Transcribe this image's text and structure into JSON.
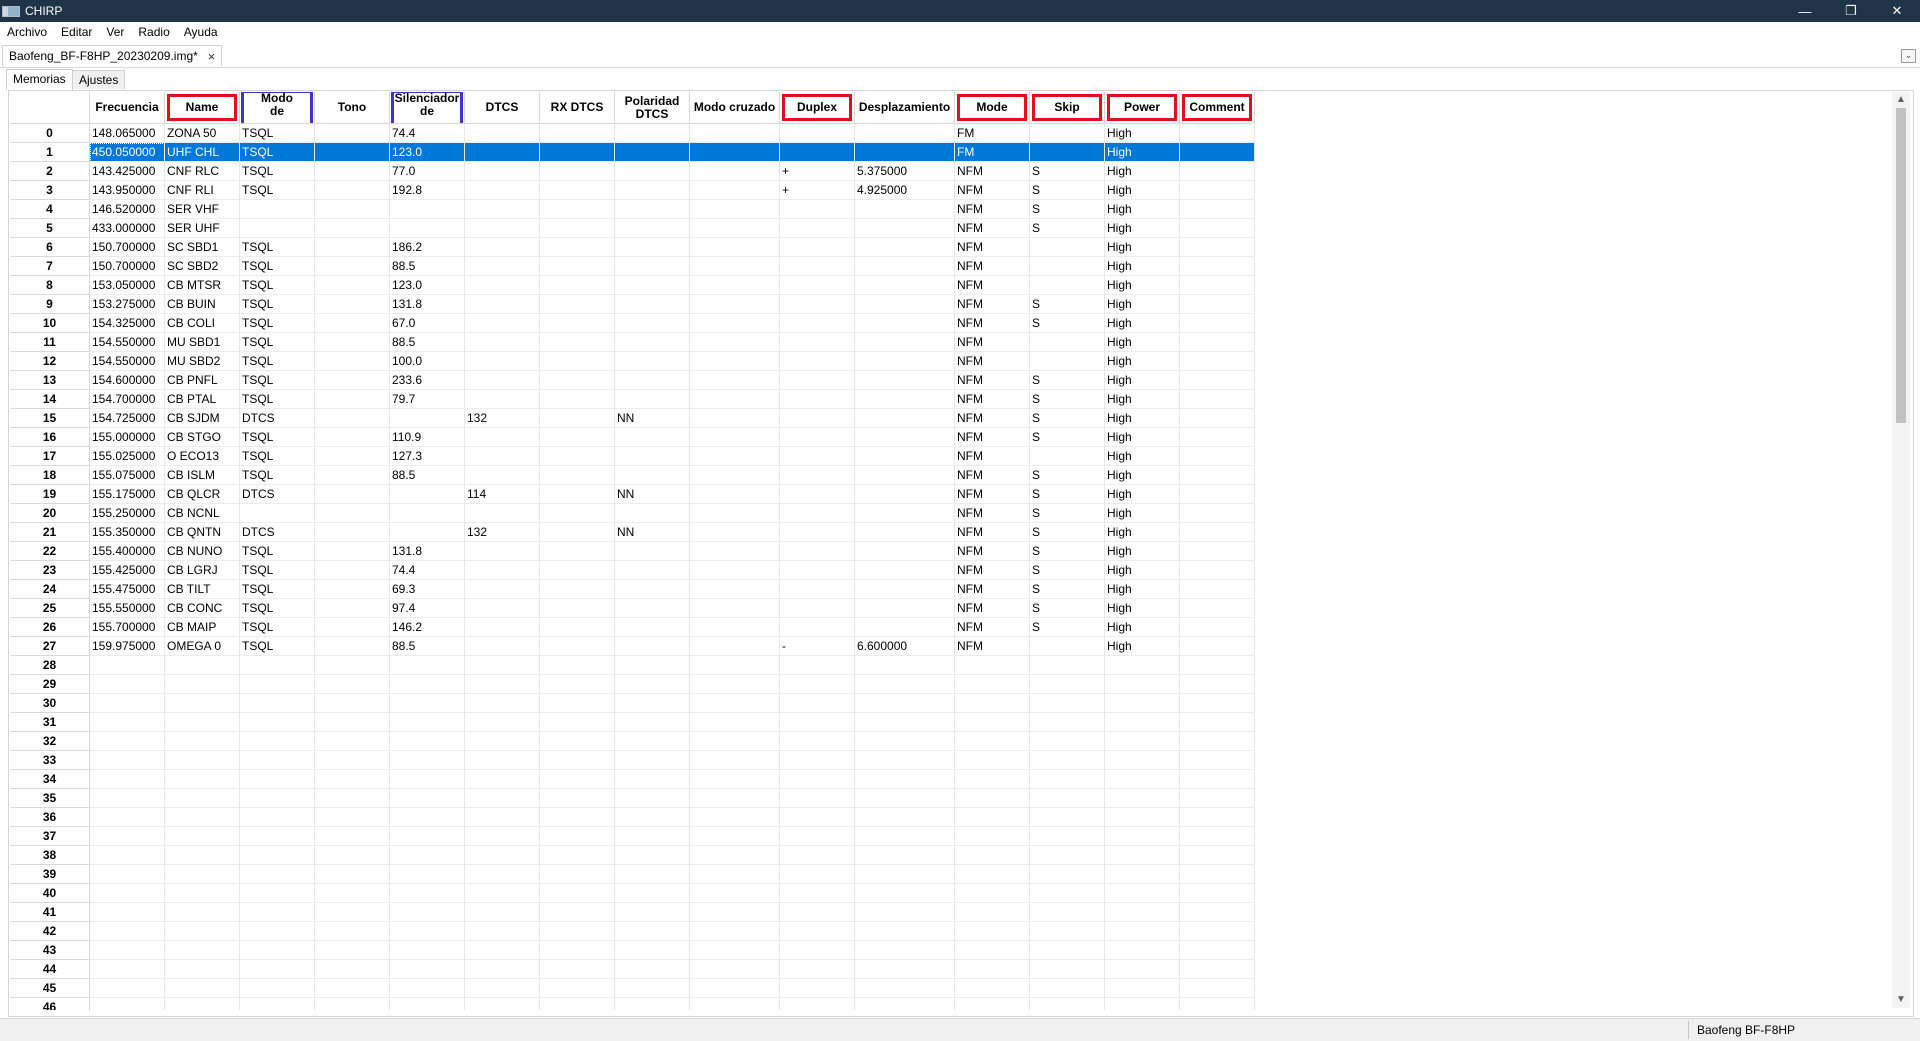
{
  "window": {
    "title": "CHIRP",
    "controls": [
      "minimize",
      "restore",
      "close"
    ]
  },
  "menu": [
    "Archivo",
    "Editar",
    "Ver",
    "Radio",
    "Ayuda"
  ],
  "doc_tab": {
    "label": "Baofeng_BF-F8HP_20230209.img*",
    "close": "×",
    "dropdown": "⌄"
  },
  "sub_tabs": [
    "Memorias",
    "Ajustes"
  ],
  "active_sub_tab": "Memorias",
  "highlights": {
    "red": "#e0111b",
    "blue": "#3d35c9"
  },
  "columns": [
    {
      "key": "freq",
      "label": "Frecuencia",
      "highlight": ""
    },
    {
      "key": "name",
      "label": "Name",
      "highlight": "red"
    },
    {
      "key": "tmode",
      "label": "Modo\nde",
      "highlight": "blue"
    },
    {
      "key": "tone",
      "label": "Tono",
      "highlight": ""
    },
    {
      "key": "ctone",
      "label": "Silenciador\nde",
      "highlight": "blue"
    },
    {
      "key": "dtcs",
      "label": "DTCS",
      "highlight": ""
    },
    {
      "key": "rxdtcs",
      "label": "RX DTCS",
      "highlight": ""
    },
    {
      "key": "pol",
      "label": "Polaridad\nDTCS",
      "highlight": ""
    },
    {
      "key": "cross",
      "label": "Modo cruzado",
      "highlight": ""
    },
    {
      "key": "duplex",
      "label": "Duplex",
      "highlight": "red"
    },
    {
      "key": "offset",
      "label": "Desplazamiento",
      "highlight": ""
    },
    {
      "key": "mode",
      "label": "Mode",
      "highlight": "red"
    },
    {
      "key": "skip",
      "label": "Skip",
      "highlight": "red"
    },
    {
      "key": "power",
      "label": "Power",
      "highlight": "red"
    },
    {
      "key": "comment",
      "label": "Comment",
      "highlight": "red"
    }
  ],
  "selected_row": 1,
  "rows": [
    {
      "n": "0",
      "freq": "148.065000",
      "name": "ZONA 50",
      "tmode": "TSQL",
      "tone": "",
      "ctone": "74.4",
      "dtcs": "",
      "rxdtcs": "",
      "pol": "",
      "cross": "",
      "duplex": "",
      "offset": "",
      "mode": "FM",
      "skip": "",
      "power": "High",
      "comment": ""
    },
    {
      "n": "1",
      "freq": "450.050000",
      "name": "UHF CHL",
      "tmode": "TSQL",
      "tone": "",
      "ctone": "123.0",
      "dtcs": "",
      "rxdtcs": "",
      "pol": "",
      "cross": "",
      "duplex": "",
      "offset": "",
      "mode": "FM",
      "skip": "",
      "power": "High",
      "comment": ""
    },
    {
      "n": "2",
      "freq": "143.425000",
      "name": "CNF RLC",
      "tmode": "TSQL",
      "tone": "",
      "ctone": "77.0",
      "dtcs": "",
      "rxdtcs": "",
      "pol": "",
      "cross": "",
      "duplex": "+",
      "offset": "5.375000",
      "mode": "NFM",
      "skip": "S",
      "power": "High",
      "comment": ""
    },
    {
      "n": "3",
      "freq": "143.950000",
      "name": "CNF RLI",
      "tmode": "TSQL",
      "tone": "",
      "ctone": "192.8",
      "dtcs": "",
      "rxdtcs": "",
      "pol": "",
      "cross": "",
      "duplex": "+",
      "offset": "4.925000",
      "mode": "NFM",
      "skip": "S",
      "power": "High",
      "comment": ""
    },
    {
      "n": "4",
      "freq": "146.520000",
      "name": "SER VHF",
      "tmode": "",
      "tone": "",
      "ctone": "",
      "dtcs": "",
      "rxdtcs": "",
      "pol": "",
      "cross": "",
      "duplex": "",
      "offset": "",
      "mode": "NFM",
      "skip": "S",
      "power": "High",
      "comment": ""
    },
    {
      "n": "5",
      "freq": "433.000000",
      "name": "SER UHF",
      "tmode": "",
      "tone": "",
      "ctone": "",
      "dtcs": "",
      "rxdtcs": "",
      "pol": "",
      "cross": "",
      "duplex": "",
      "offset": "",
      "mode": "NFM",
      "skip": "S",
      "power": "High",
      "comment": ""
    },
    {
      "n": "6",
      "freq": "150.700000",
      "name": "SC SBD1",
      "tmode": "TSQL",
      "tone": "",
      "ctone": "186.2",
      "dtcs": "",
      "rxdtcs": "",
      "pol": "",
      "cross": "",
      "duplex": "",
      "offset": "",
      "mode": "NFM",
      "skip": "",
      "power": "High",
      "comment": ""
    },
    {
      "n": "7",
      "freq": "150.700000",
      "name": "SC SBD2",
      "tmode": "TSQL",
      "tone": "",
      "ctone": "88.5",
      "dtcs": "",
      "rxdtcs": "",
      "pol": "",
      "cross": "",
      "duplex": "",
      "offset": "",
      "mode": "NFM",
      "skip": "",
      "power": "High",
      "comment": ""
    },
    {
      "n": "8",
      "freq": "153.050000",
      "name": "CB MTSR",
      "tmode": "TSQL",
      "tone": "",
      "ctone": "123.0",
      "dtcs": "",
      "rxdtcs": "",
      "pol": "",
      "cross": "",
      "duplex": "",
      "offset": "",
      "mode": "NFM",
      "skip": "",
      "power": "High",
      "comment": ""
    },
    {
      "n": "9",
      "freq": "153.275000",
      "name": "CB BUIN",
      "tmode": "TSQL",
      "tone": "",
      "ctone": "131.8",
      "dtcs": "",
      "rxdtcs": "",
      "pol": "",
      "cross": "",
      "duplex": "",
      "offset": "",
      "mode": "NFM",
      "skip": "S",
      "power": "High",
      "comment": ""
    },
    {
      "n": "10",
      "freq": "154.325000",
      "name": "CB COLI",
      "tmode": "TSQL",
      "tone": "",
      "ctone": "67.0",
      "dtcs": "",
      "rxdtcs": "",
      "pol": "",
      "cross": "",
      "duplex": "",
      "offset": "",
      "mode": "NFM",
      "skip": "S",
      "power": "High",
      "comment": ""
    },
    {
      "n": "11",
      "freq": "154.550000",
      "name": "MU SBD1",
      "tmode": "TSQL",
      "tone": "",
      "ctone": "88.5",
      "dtcs": "",
      "rxdtcs": "",
      "pol": "",
      "cross": "",
      "duplex": "",
      "offset": "",
      "mode": "NFM",
      "skip": "",
      "power": "High",
      "comment": ""
    },
    {
      "n": "12",
      "freq": "154.550000",
      "name": "MU SBD2",
      "tmode": "TSQL",
      "tone": "",
      "ctone": "100.0",
      "dtcs": "",
      "rxdtcs": "",
      "pol": "",
      "cross": "",
      "duplex": "",
      "offset": "",
      "mode": "NFM",
      "skip": "",
      "power": "High",
      "comment": ""
    },
    {
      "n": "13",
      "freq": "154.600000",
      "name": "CB PNFL",
      "tmode": "TSQL",
      "tone": "",
      "ctone": "233.6",
      "dtcs": "",
      "rxdtcs": "",
      "pol": "",
      "cross": "",
      "duplex": "",
      "offset": "",
      "mode": "NFM",
      "skip": "S",
      "power": "High",
      "comment": ""
    },
    {
      "n": "14",
      "freq": "154.700000",
      "name": "CB PTAL",
      "tmode": "TSQL",
      "tone": "",
      "ctone": "79.7",
      "dtcs": "",
      "rxdtcs": "",
      "pol": "",
      "cross": "",
      "duplex": "",
      "offset": "",
      "mode": "NFM",
      "skip": "S",
      "power": "High",
      "comment": ""
    },
    {
      "n": "15",
      "freq": "154.725000",
      "name": "CB SJDM",
      "tmode": "DTCS",
      "tone": "",
      "ctone": "",
      "dtcs": "132",
      "rxdtcs": "",
      "pol": "NN",
      "cross": "",
      "duplex": "",
      "offset": "",
      "mode": "NFM",
      "skip": "S",
      "power": "High",
      "comment": ""
    },
    {
      "n": "16",
      "freq": "155.000000",
      "name": "CB STGO",
      "tmode": "TSQL",
      "tone": "",
      "ctone": "110.9",
      "dtcs": "",
      "rxdtcs": "",
      "pol": "",
      "cross": "",
      "duplex": "",
      "offset": "",
      "mode": "NFM",
      "skip": "S",
      "power": "High",
      "comment": ""
    },
    {
      "n": "17",
      "freq": "155.025000",
      "name": "O ECO13",
      "tmode": "TSQL",
      "tone": "",
      "ctone": "127.3",
      "dtcs": "",
      "rxdtcs": "",
      "pol": "",
      "cross": "",
      "duplex": "",
      "offset": "",
      "mode": "NFM",
      "skip": "",
      "power": "High",
      "comment": ""
    },
    {
      "n": "18",
      "freq": "155.075000",
      "name": "CB ISLM",
      "tmode": "TSQL",
      "tone": "",
      "ctone": "88.5",
      "dtcs": "",
      "rxdtcs": "",
      "pol": "",
      "cross": "",
      "duplex": "",
      "offset": "",
      "mode": "NFM",
      "skip": "S",
      "power": "High",
      "comment": ""
    },
    {
      "n": "19",
      "freq": "155.175000",
      "name": "CB QLCR",
      "tmode": "DTCS",
      "tone": "",
      "ctone": "",
      "dtcs": "114",
      "rxdtcs": "",
      "pol": "NN",
      "cross": "",
      "duplex": "",
      "offset": "",
      "mode": "NFM",
      "skip": "S",
      "power": "High",
      "comment": ""
    },
    {
      "n": "20",
      "freq": "155.250000",
      "name": "CB NCNL",
      "tmode": "",
      "tone": "",
      "ctone": "",
      "dtcs": "",
      "rxdtcs": "",
      "pol": "",
      "cross": "",
      "duplex": "",
      "offset": "",
      "mode": "NFM",
      "skip": "S",
      "power": "High",
      "comment": ""
    },
    {
      "n": "21",
      "freq": "155.350000",
      "name": "CB QNTN",
      "tmode": "DTCS",
      "tone": "",
      "ctone": "",
      "dtcs": "132",
      "rxdtcs": "",
      "pol": "NN",
      "cross": "",
      "duplex": "",
      "offset": "",
      "mode": "NFM",
      "skip": "S",
      "power": "High",
      "comment": ""
    },
    {
      "n": "22",
      "freq": "155.400000",
      "name": "CB NUNO",
      "tmode": "TSQL",
      "tone": "",
      "ctone": "131.8",
      "dtcs": "",
      "rxdtcs": "",
      "pol": "",
      "cross": "",
      "duplex": "",
      "offset": "",
      "mode": "NFM",
      "skip": "S",
      "power": "High",
      "comment": ""
    },
    {
      "n": "23",
      "freq": "155.425000",
      "name": "CB LGRJ",
      "tmode": "TSQL",
      "tone": "",
      "ctone": "74.4",
      "dtcs": "",
      "rxdtcs": "",
      "pol": "",
      "cross": "",
      "duplex": "",
      "offset": "",
      "mode": "NFM",
      "skip": "S",
      "power": "High",
      "comment": ""
    },
    {
      "n": "24",
      "freq": "155.475000",
      "name": "CB TILT",
      "tmode": "TSQL",
      "tone": "",
      "ctone": "69.3",
      "dtcs": "",
      "rxdtcs": "",
      "pol": "",
      "cross": "",
      "duplex": "",
      "offset": "",
      "mode": "NFM",
      "skip": "S",
      "power": "High",
      "comment": ""
    },
    {
      "n": "25",
      "freq": "155.550000",
      "name": "CB CONC",
      "tmode": "TSQL",
      "tone": "",
      "ctone": "97.4",
      "dtcs": "",
      "rxdtcs": "",
      "pol": "",
      "cross": "",
      "duplex": "",
      "offset": "",
      "mode": "NFM",
      "skip": "S",
      "power": "High",
      "comment": ""
    },
    {
      "n": "26",
      "freq": "155.700000",
      "name": "CB MAIP",
      "tmode": "TSQL",
      "tone": "",
      "ctone": "146.2",
      "dtcs": "",
      "rxdtcs": "",
      "pol": "",
      "cross": "",
      "duplex": "",
      "offset": "",
      "mode": "NFM",
      "skip": "S",
      "power": "High",
      "comment": ""
    },
    {
      "n": "27",
      "freq": "159.975000",
      "name": "OMEGA 0",
      "tmode": "TSQL",
      "tone": "",
      "ctone": "88.5",
      "dtcs": "",
      "rxdtcs": "",
      "pol": "",
      "cross": "",
      "duplex": "-",
      "offset": "6.600000",
      "mode": "NFM",
      "skip": "",
      "power": "High",
      "comment": ""
    },
    {
      "n": "28"
    },
    {
      "n": "29"
    },
    {
      "n": "30"
    },
    {
      "n": "31"
    },
    {
      "n": "32"
    },
    {
      "n": "33"
    },
    {
      "n": "34"
    },
    {
      "n": "35"
    },
    {
      "n": "36"
    },
    {
      "n": "37"
    },
    {
      "n": "38"
    },
    {
      "n": "39"
    },
    {
      "n": "40"
    },
    {
      "n": "41"
    },
    {
      "n": "42"
    },
    {
      "n": "43"
    },
    {
      "n": "44"
    },
    {
      "n": "45"
    },
    {
      "n": "46"
    }
  ],
  "status": {
    "radio_model": "Baofeng BF-F8HP"
  }
}
